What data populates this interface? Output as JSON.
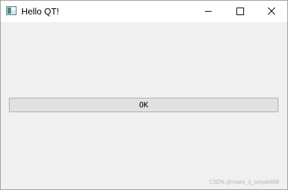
{
  "window": {
    "title": "Hello QT!",
    "app_icon": "qt-window-icon",
    "controls": {
      "minimize_icon": "minimize-icon",
      "maximize_icon": "maximize-icon",
      "close_icon": "close-icon"
    }
  },
  "main": {
    "ok_button_label": "OK"
  },
  "watermark": "CSDN @make_it_simple888",
  "colors": {
    "titlebar": "#ffffff",
    "client_background": "#f0f0f0",
    "button_face": "#e1e1e1",
    "button_border": "#adadad"
  }
}
